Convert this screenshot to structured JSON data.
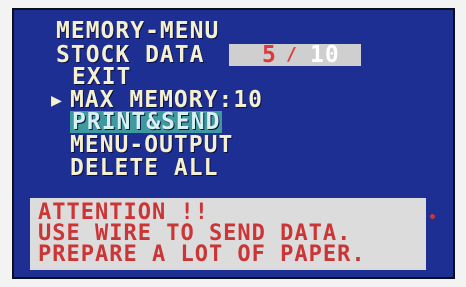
{
  "menu": {
    "title": "MEMORY-MENU",
    "stock_label": "STOCK DATA",
    "stock_current": "5",
    "stock_separator": "/",
    "stock_total": "10",
    "exit": "EXIT",
    "cursor": "▶",
    "max_memory": "MAX MEMORY:10",
    "print_send": "PRINT&SEND",
    "menu_output": "MENU-OUTPUT",
    "delete_all": "DELETE ALL"
  },
  "attention": {
    "line1": "ATTENTION !!",
    "line2": "USE WIRE TO SEND DATA.",
    "line3": "PREPARE A LOT OF PAPER."
  },
  "colors": {
    "screen_bg": "#1d2f93",
    "text": "#f5f0d0",
    "highlight_bg": "#3f9aa0",
    "warning_text": "#cc3535",
    "stock_current": "#e0383f"
  }
}
